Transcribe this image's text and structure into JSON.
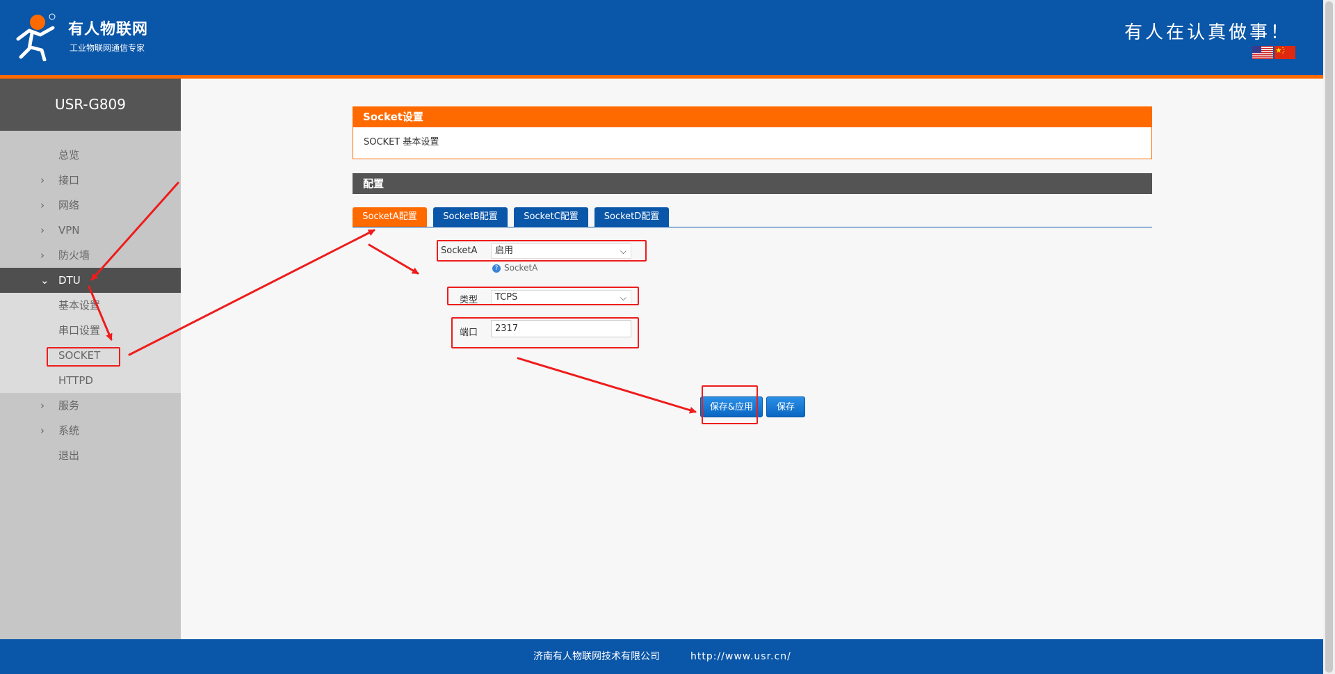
{
  "header": {
    "brand_name": "有人物联网",
    "brand_slogan": "工业物联网通信专家",
    "motto": "有人在认真做事！",
    "logo_icon": "usr-person-logo",
    "languages": [
      "english-flag-icon",
      "chinese-flag-icon"
    ]
  },
  "sidebar": {
    "device": "USR-G809",
    "items": [
      {
        "label": "总览",
        "chevron": ""
      },
      {
        "label": "接口",
        "chevron": "›"
      },
      {
        "label": "网络",
        "chevron": "›"
      },
      {
        "label": "VPN",
        "chevron": "›"
      },
      {
        "label": "防火墙",
        "chevron": "›"
      },
      {
        "label": "DTU",
        "chevron": "⌄"
      },
      {
        "label": "服务",
        "chevron": "›"
      },
      {
        "label": "系统",
        "chevron": "›"
      },
      {
        "label": "退出",
        "chevron": ""
      }
    ],
    "dtu_sub": [
      "基本设置",
      "串口设置",
      "SOCKET",
      "HTTPD"
    ]
  },
  "main": {
    "section_title": "Socket设置",
    "section_desc": "SOCKET 基本设置",
    "config_title": "配置",
    "tabs": [
      "SocketA配置",
      "SocketB配置",
      "SocketC配置",
      "SocketD配置"
    ],
    "form": {
      "socket_label": "SocketA",
      "socket_value": "启用",
      "socket_hint": "SocketA",
      "type_label": "类型",
      "type_value": "TCPS",
      "port_label": "端口",
      "port_value": "2317"
    },
    "buttons": {
      "save_apply": "保存&应用",
      "save": "保存"
    }
  },
  "footer": {
    "company": "济南有人物联网技术有限公司",
    "site": "http://www.usr.cn/"
  },
  "colors": {
    "header_blue": "#0a56a8",
    "accent_orange": "#ff6a00",
    "annotation_red": "#ee1c1c"
  }
}
